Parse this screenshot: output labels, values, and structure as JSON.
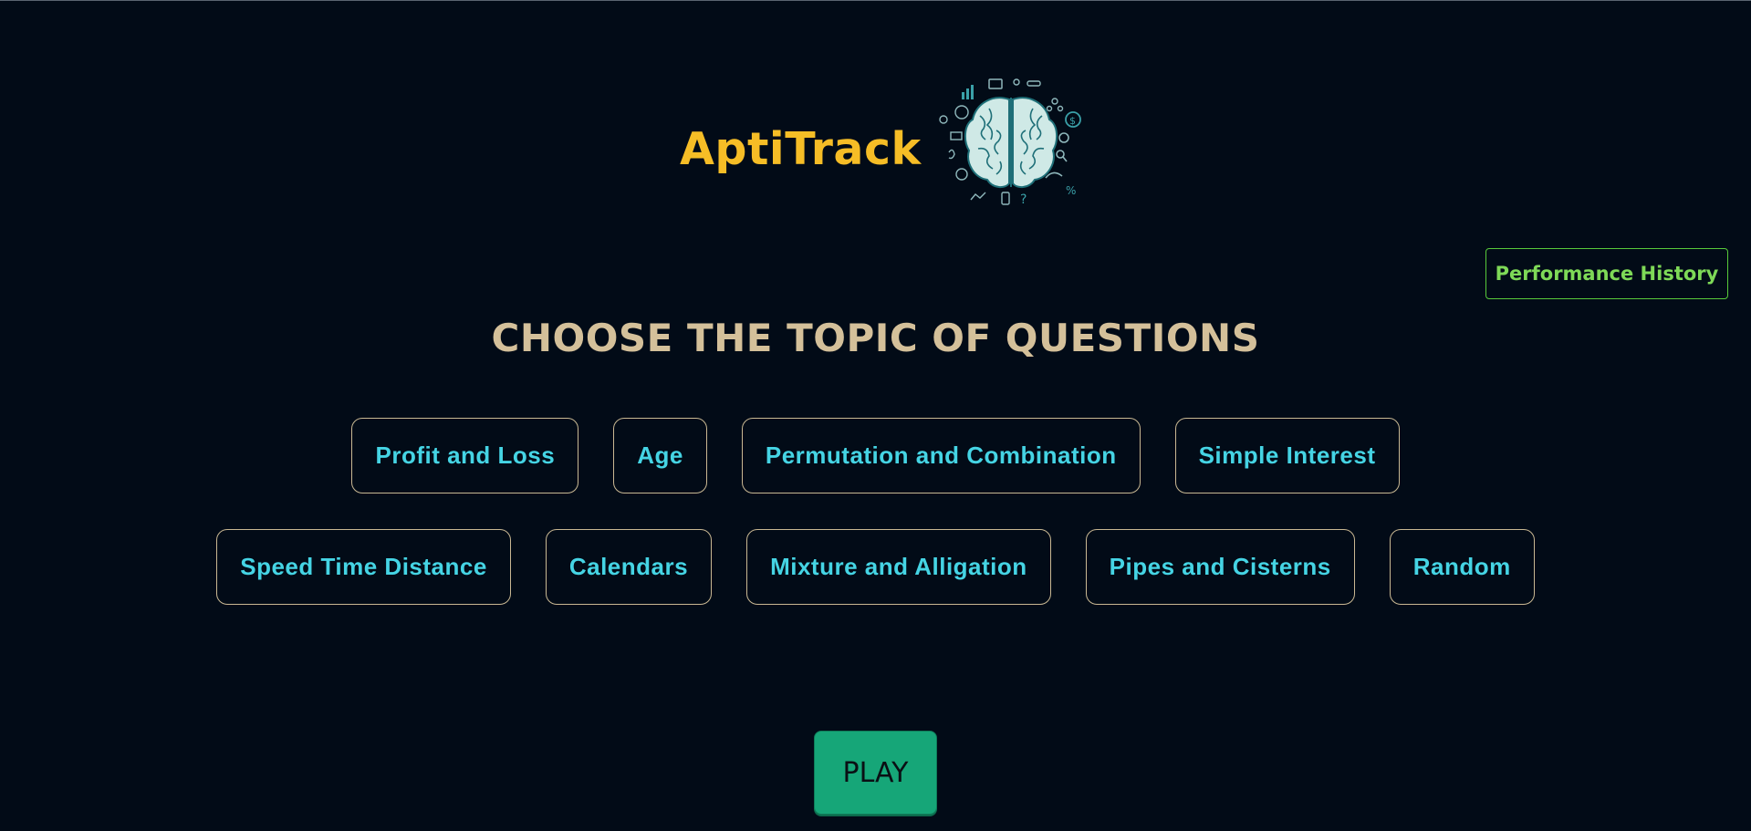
{
  "brand": {
    "title": "AptiTrack",
    "logo_icon": "brain-icon"
  },
  "header": {
    "performance_button": "Performance History"
  },
  "main": {
    "heading": "CHOOSE THE TOPIC OF QUESTIONS",
    "topics_row1": [
      {
        "label": "Profit and Loss"
      },
      {
        "label": "Age"
      },
      {
        "label": "Permutation and Combination"
      },
      {
        "label": "Simple Interest"
      }
    ],
    "topics_row2": [
      {
        "label": "Speed Time Distance"
      },
      {
        "label": "Calendars"
      },
      {
        "label": "Mixture and Alligation"
      },
      {
        "label": "Pipes and Cisterns"
      },
      {
        "label": "Random"
      }
    ],
    "play_button": "PLAY"
  },
  "colors": {
    "background": "#020b17",
    "brand": "#f6bd26",
    "heading": "#d4c09a",
    "topic_text": "#45d4e4",
    "topic_border": "#c9b893",
    "performance": "#7ed957",
    "play": "#16a678"
  }
}
